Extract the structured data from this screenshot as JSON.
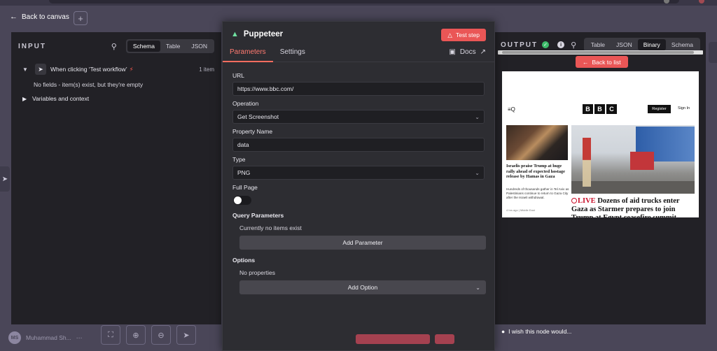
{
  "top": {
    "back_label": "Back to canvas",
    "add_symbol": "+"
  },
  "input_panel": {
    "title": "INPUT",
    "view_tabs": [
      "Schema",
      "Table",
      "JSON"
    ],
    "active_tab": "Schema",
    "trigger_name": "When clicking ‘Test workflow’",
    "item_count": "1 item",
    "empty_note": "No fields - item(s) exist, but they're empty",
    "variables_label": "Variables and context"
  },
  "modal": {
    "node_name": "Puppeteer",
    "test_button": "Test step",
    "tabs": [
      "Parameters",
      "Settings"
    ],
    "docs_label": "Docs",
    "fields": {
      "url_label": "URL",
      "url_value": "https://www.bbc.com/",
      "operation_label": "Operation",
      "operation_value": "Get Screenshot",
      "property_label": "Property Name",
      "property_value": "data",
      "type_label": "Type",
      "type_value": "PNG",
      "fullpage_label": "Full Page",
      "fullpage_on": false
    },
    "query": {
      "label": "Query Parameters",
      "empty_note": "Currently no items exist",
      "add_button": "Add Parameter"
    },
    "options": {
      "label": "Options",
      "empty_note": "No properties",
      "add_button": "Add Option"
    }
  },
  "output_panel": {
    "title": "OUTPUT",
    "view_tabs": [
      "Table",
      "JSON",
      "Binary",
      "Schema"
    ],
    "active_tab": "Binary",
    "back_to_list": "Back to list",
    "preview": {
      "logo_letters": [
        "B",
        "B",
        "C"
      ],
      "register": "Register",
      "sign_in": "Sign In",
      "menu": "≡Q",
      "left_headline": "Israelis praise Trump at huge rally ahead of expected hostage release by Hamas in Gaza",
      "left_summary": "Hundreds of thousands gather in Tel Aviv as Palestinians continue to return to Gaza City after the Israeli withdrawal.",
      "left_meta": "4 hrs ago  |  Middle East",
      "live_label": "LIVE",
      "main_headline": "Dozens of aid trucks enter Gaza as Starmer prepares to join Trump at Egypt ceasefire summit"
    }
  },
  "bottom": {
    "user_initials": "MS",
    "user_name": "Muhammad Sh...",
    "user_more": "⋯",
    "wish_text": "I wish this node would..."
  },
  "colors": {
    "accent": "#ea5656",
    "canvas_bg": "#4a4658",
    "panel_bg": "#222126",
    "modal_bg": "#2d2d32",
    "success": "#3dbb6a"
  }
}
